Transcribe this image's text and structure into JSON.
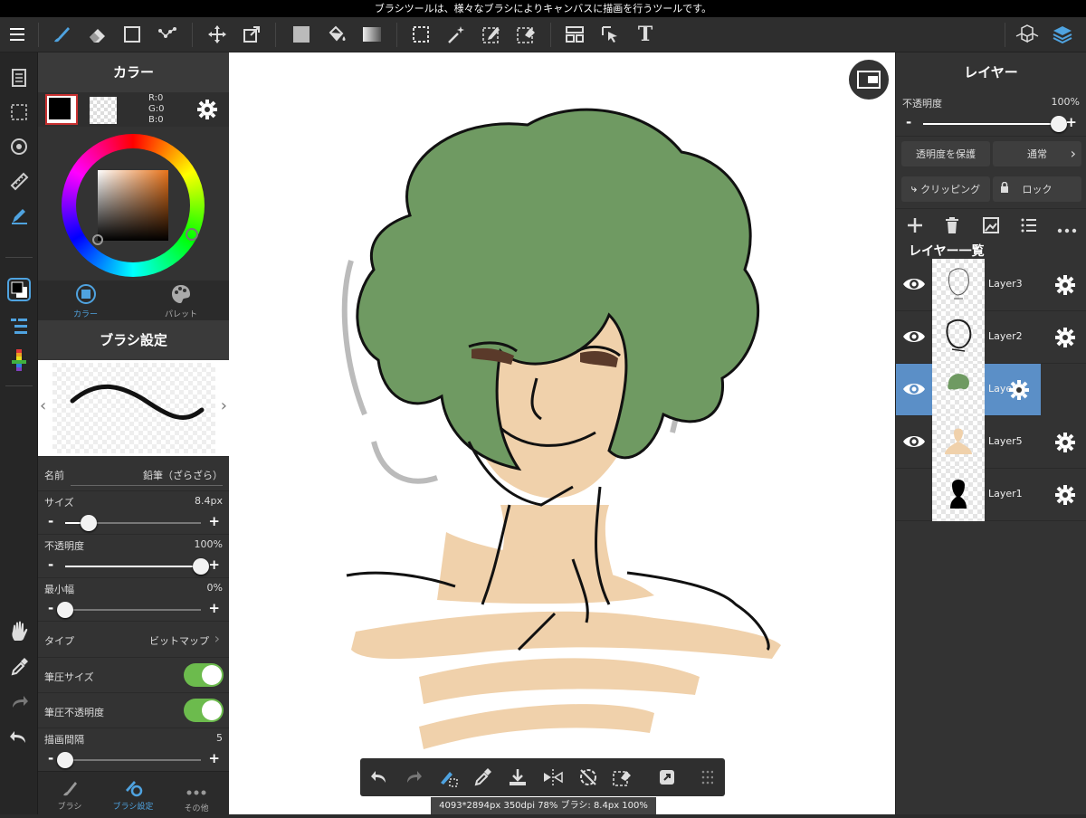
{
  "statusbar": {
    "hint": "ブラシツールは、様々なブラシによりキャンバスに描画を行うツールです。"
  },
  "toolbar": {
    "icons": [
      "menu-icon",
      "brush-icon",
      "eraser-icon",
      "rectangle-icon",
      "dot-icon",
      "move-icon",
      "transform-icon",
      "fill-color-icon",
      "bucket-icon",
      "gradient-icon",
      "select-icon",
      "magic-wand-icon",
      "select-pen-icon",
      "select-eraser-icon",
      "layout-icon",
      "pointer-icon",
      "text-icon",
      "3d-icon",
      "layers-icon"
    ],
    "text_tool_label": "T"
  },
  "color_panel": {
    "title": "カラー",
    "rgb": {
      "r": "R:0",
      "g": "G:0",
      "b": "B:0"
    },
    "tab_color": "カラー",
    "tab_palette": "パレット",
    "main_color": "#000000",
    "accent": "#4a90c8"
  },
  "brush_panel": {
    "title": "ブラシ設定",
    "name_label": "名前",
    "name_value": "鉛筆（ざらざら）",
    "size_label": "サイズ",
    "size_value": "8.4px",
    "size_fraction": 0.17,
    "opacity_label": "不透明度",
    "opacity_value": "100%",
    "opacity_fraction": 1.0,
    "minwidth_label": "最小幅",
    "minwidth_value": "0%",
    "minwidth_fraction": 0.0,
    "type_label": "タイプ",
    "type_value": "ビットマップ",
    "pressure_size_label": "筆圧サイズ",
    "pressure_size_on": true,
    "pressure_opacity_label": "筆圧不透明度",
    "pressure_opacity_on": true,
    "interval_label": "描画間隔",
    "interval_value": "5",
    "interval_fraction": 0.0,
    "tabs": [
      "ブラシ",
      "ブラシ設定",
      "その他"
    ]
  },
  "layer_panel": {
    "title": "レイヤー",
    "opacity_label": "不透明度",
    "opacity_value": "100%",
    "opacity_fraction": 1.0,
    "protect_label": "透明度を保護",
    "blend_label": "通常",
    "clipping_label": "クリッピング",
    "lock_label": "ロック",
    "list_title": "レイヤー一覧",
    "layers": [
      {
        "name": "Layer3",
        "visible": true,
        "selected": false
      },
      {
        "name": "Layer2",
        "visible": true,
        "selected": false
      },
      {
        "name": "Layer4",
        "visible": true,
        "selected": true
      },
      {
        "name": "Layer5",
        "visible": true,
        "selected": false
      },
      {
        "name": "Layer1",
        "visible": false,
        "selected": false
      }
    ],
    "selected_color": "#5b8fc7"
  },
  "infobar": {
    "text": "4093*2894px 350dpi 78% ブラシ: 8.4px 100%"
  },
  "colors": {
    "hair": "#6f9a62",
    "skin": "#f0d1ab",
    "ink": "#111111"
  }
}
